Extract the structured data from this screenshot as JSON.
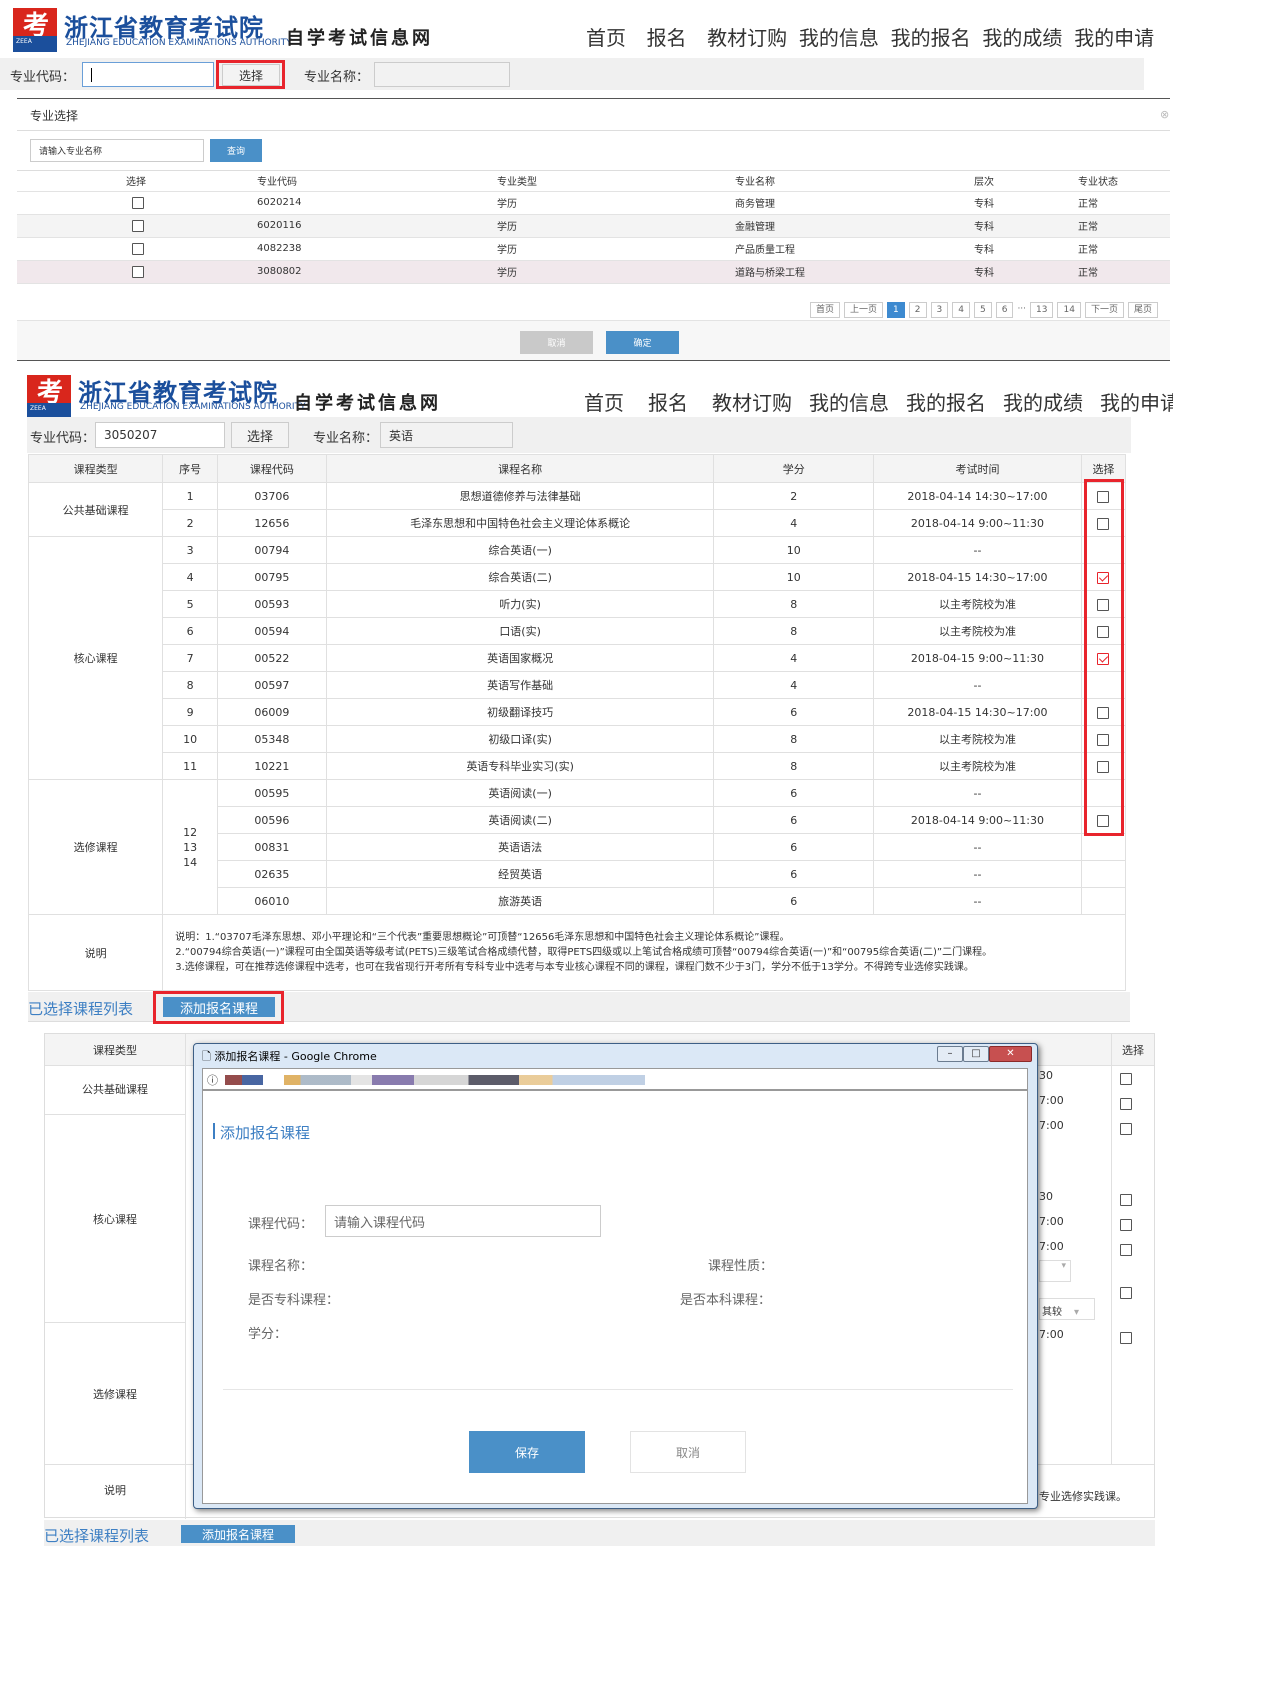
{
  "logo": {
    "mark": "考",
    "mark_sub": "ZEEA",
    "title": "浙江省教育考试院",
    "subtitle": "ZHEJIANG EDUCATION EXAMINATIONS AUTHORITY",
    "site": "自学考试信息网"
  },
  "nav": [
    "首页",
    "报名",
    "教材订购",
    "我的信息",
    "我的报名",
    "我的成绩",
    "我的申请"
  ],
  "panel1": {
    "code_label": "专业代码：",
    "choose_btn": "选择",
    "name_label": "专业名称：",
    "dialog_title": "专业选择",
    "search_placeholder": "请输入专业名称",
    "query_btn": "查询",
    "headers": [
      "选择",
      "专业代码",
      "专业类型",
      "专业名称",
      "层次",
      "专业状态"
    ],
    "rows": [
      [
        "6020214",
        "学历",
        "商务管理",
        "专科",
        "正常"
      ],
      [
        "6020116",
        "学历",
        "金融管理",
        "专科",
        "正常"
      ],
      [
        "4082238",
        "学历",
        "产品质量工程",
        "专科",
        "正常"
      ],
      [
        "3080802",
        "学历",
        "道路与桥梁工程",
        "专科",
        "正常"
      ]
    ],
    "pager": [
      "首页",
      "上一页",
      "1",
      "2",
      "3",
      "4",
      "5",
      "6",
      "···",
      "13",
      "14",
      "下一页",
      "尾页"
    ],
    "cancel_btn": "取消",
    "ok_btn": "确定"
  },
  "panel2": {
    "code_label": "专业代码：",
    "code_value": "3050207",
    "choose_btn": "选择",
    "name_label": "专业名称：",
    "name_value": "英语",
    "headers": [
      "课程类型",
      "序号",
      "课程代码",
      "课程名称",
      "学分",
      "考试时间",
      "选择"
    ],
    "groups": {
      "public": "公共基础课程",
      "core": "核心课程",
      "elective": "选修课程",
      "note": "说明"
    },
    "elective_seq": [
      "12",
      "13",
      "14"
    ],
    "rows": [
      {
        "seq": "1",
        "code": "03706",
        "name": "思想道德修养与法律基础",
        "credit": "2",
        "time": "2018-04-14 14:30~17:00",
        "cb": "off"
      },
      {
        "seq": "2",
        "code": "12656",
        "name": "毛泽东思想和中国特色社会主义理论体系概论",
        "credit": "4",
        "time": "2018-04-14 9:00~11:30",
        "cb": "off"
      },
      {
        "seq": "3",
        "code": "00794",
        "name": "综合英语(一)",
        "credit": "10",
        "time": "--",
        "cb": "none"
      },
      {
        "seq": "4",
        "code": "00795",
        "name": "综合英语(二)",
        "credit": "10",
        "time": "2018-04-15 14:30~17:00",
        "cb": "on"
      },
      {
        "seq": "5",
        "code": "00593",
        "name": "听力(实)",
        "credit": "8",
        "time": "以主考院校为准",
        "cb": "off"
      },
      {
        "seq": "6",
        "code": "00594",
        "name": "口语(实)",
        "credit": "8",
        "time": "以主考院校为准",
        "cb": "off"
      },
      {
        "seq": "7",
        "code": "00522",
        "name": "英语国家概况",
        "credit": "4",
        "time": "2018-04-15 9:00~11:30",
        "cb": "on"
      },
      {
        "seq": "8",
        "code": "00597",
        "name": "英语写作基础",
        "credit": "4",
        "time": "--",
        "cb": "none"
      },
      {
        "seq": "9",
        "code": "06009",
        "name": "初级翻译技巧",
        "credit": "6",
        "time": "2018-04-15 14:30~17:00",
        "cb": "off"
      },
      {
        "seq": "10",
        "code": "05348",
        "name": "初级口译(实)",
        "credit": "8",
        "time": "以主考院校为准",
        "cb": "off"
      },
      {
        "seq": "11",
        "code": "10221",
        "name": "英语专科毕业实习(实)",
        "credit": "8",
        "time": "以主考院校为准",
        "cb": "off"
      },
      {
        "seq": "",
        "code": "00595",
        "name": "英语阅读(一)",
        "credit": "6",
        "time": "--",
        "cb": "none"
      },
      {
        "seq": "",
        "code": "00596",
        "name": "英语阅读(二)",
        "credit": "6",
        "time": "2018-04-14 9:00~11:30",
        "cb": "off"
      },
      {
        "seq": "",
        "code": "00831",
        "name": "英语语法",
        "credit": "6",
        "time": "--",
        "cb": "none"
      },
      {
        "seq": "",
        "code": "02635",
        "name": "经贸英语",
        "credit": "6",
        "time": "--",
        "cb": "none"
      },
      {
        "seq": "",
        "code": "06010",
        "name": "旅游英语",
        "credit": "6",
        "time": "--",
        "cb": "none"
      }
    ],
    "note_lines": [
      "说明：1.“03707毛泽东思想、邓小平理论和“三个代表”重要思想概论”可顶替“12656毛泽东思想和中国特色社会主义理论体系概论”课程。",
      "2.“00794综合英语(一)”课程可由全国英语等级考试(PETS)三级笔试合格成绩代替，取得PETS四级或以上笔试合格成绩可顶替“00794综合英语(一)”和“00795综合英语(二)”二门课程。",
      "3.选修课程，可在推荐选修课程中选考，也可在我省现行开考所有专科专业中选考与本专业核心课程不同的课程，课程门数不少于3门，学分不低于13学分。不得跨专业选修实践课。"
    ],
    "selected_list_label": "已选择课程列表",
    "add_btn": "添加报名课程"
  },
  "panel3": {
    "bg_headers": [
      "课程类型",
      "选择"
    ],
    "bg_groups": [
      "公共基础课程",
      "核心课程",
      "选修课程",
      "说明"
    ],
    "bg_times": [
      "30",
      "7:00",
      "7:00",
      "30",
      "7:00",
      "7:00",
      "7:00"
    ],
    "bg_select_text": "其较",
    "bg_note_tail": "专业选修实践课。",
    "selected_list_label": "已选择课程列表",
    "add_btn": "添加报名课程",
    "modal": {
      "window_title": "添加报名课程 - Google Chrome",
      "heading": "添加报名课程",
      "code_label": "课程代码：",
      "code_placeholder": "请输入课程代码",
      "name_label": "课程名称：",
      "nature_label": "课程性质：",
      "is_zhuanke_label": "是否专科课程：",
      "is_benke_label": "是否本科课程：",
      "credit_label": "学分：",
      "save_btn": "保存",
      "cancel_btn": "取消"
    }
  },
  "colors": {
    "accent": "#4a90c8",
    "brand": "#1b4f9c",
    "red": "#e8242c",
    "logo_red": "#d9261c"
  }
}
